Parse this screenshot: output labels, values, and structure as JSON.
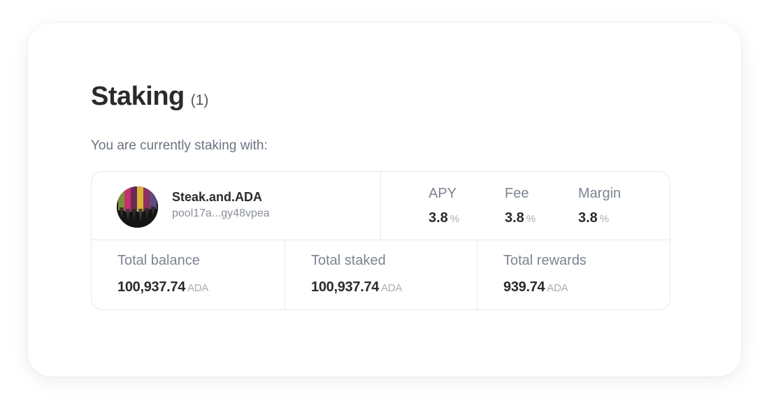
{
  "staking": {
    "title": "Staking",
    "count": "(1)",
    "subtitle": "You are currently staking with:"
  },
  "pool": {
    "name": "Steak.and.ADA",
    "id": "pool17a...gy48vpea",
    "avatar_icon": "pool-logo-icon"
  },
  "metrics": [
    {
      "label": "APY",
      "value": "3.8",
      "unit": "%"
    },
    {
      "label": "Fee",
      "value": "3.8",
      "unit": "%"
    },
    {
      "label": "Margin",
      "value": "3.8",
      "unit": "%"
    }
  ],
  "totals": [
    {
      "label": "Total balance",
      "value": "100,937.74",
      "unit": "ADA"
    },
    {
      "label": "Total staked",
      "value": "100,937.74",
      "unit": "ADA"
    },
    {
      "label": "Total rewards",
      "value": "939.74",
      "unit": "ADA"
    }
  ],
  "colors": {
    "heading": "#2b2b2b",
    "muted": "#7d8490",
    "border": "#e6e8eb"
  }
}
